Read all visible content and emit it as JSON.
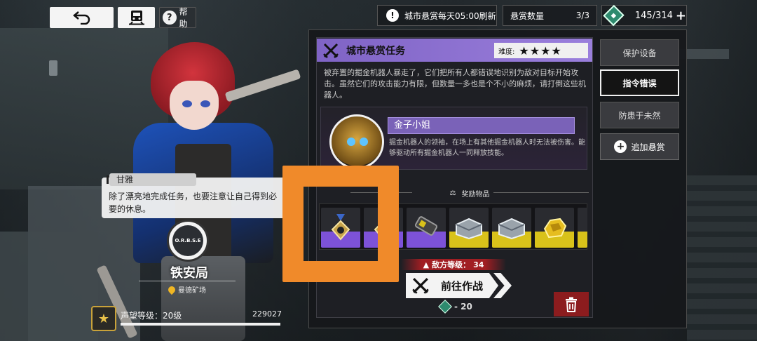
{
  "topbar": {
    "back_icon": "return-arrow-icon",
    "train_icon": "train-icon",
    "help_label": "帮助",
    "help_symbol": "?"
  },
  "status": {
    "refresh_text": "城市悬赏每天05:00刷新",
    "warn_symbol": "!",
    "bounty_label": "悬赏数量",
    "bounty_count": "3/3",
    "currency_value": "145/314",
    "currency_plus": "+"
  },
  "dialogue": {
    "speaker": "甘雅",
    "text": "除了漂亮地完成任务，也要注意让自己得到必要的休息。"
  },
  "faction": {
    "emblem_text": "O.R.B.S.E",
    "name": "铁安局",
    "location": "曼德矿场"
  },
  "reputation": {
    "label": "声望等级：20级",
    "value": "229027",
    "progress": 1.0
  },
  "mission": {
    "title": "城市悬赏任务",
    "difficulty_label": "难度:",
    "difficulty_stars": "★★★★",
    "description": "被弃置的掘金机器人暴走了，它们把所有人都错误地识别为敌对目标开始攻击。虽然它们的攻击能力有限，但数量一多也是个不小的麻烦，请打倒这些机器人。",
    "boss_name": "金子小姐",
    "boss_description": "掘金机器人的领袖，在场上有其他掘金机器人时无法被伤害。能够驱动所有掘金机器人一同释放技能。",
    "reward_label": "奖励物品",
    "enemy_level_label": "敌方等级：",
    "enemy_level": "34",
    "go_label": "前往作战",
    "cost": "- 20",
    "rewards": [
      {
        "rarity": "purple",
        "icon": "medal-icon"
      },
      {
        "rarity": "purple",
        "icon": "medal-icon"
      },
      {
        "rarity": "purple",
        "icon": "battery-icon"
      },
      {
        "rarity": "yellow",
        "icon": "crate-icon"
      },
      {
        "rarity": "yellow",
        "icon": "crate-icon"
      },
      {
        "rarity": "yellow",
        "icon": "gold-ore-icon"
      }
    ]
  },
  "tabs": {
    "tab1": "保护设备",
    "tab2": "指令错误",
    "tab3": "防患于未然",
    "add": "追加悬赏"
  },
  "colors": {
    "accent_purple": "#8b6fd2",
    "highlight_orange": "#f08a2a",
    "danger_red": "#8c1c1e"
  }
}
